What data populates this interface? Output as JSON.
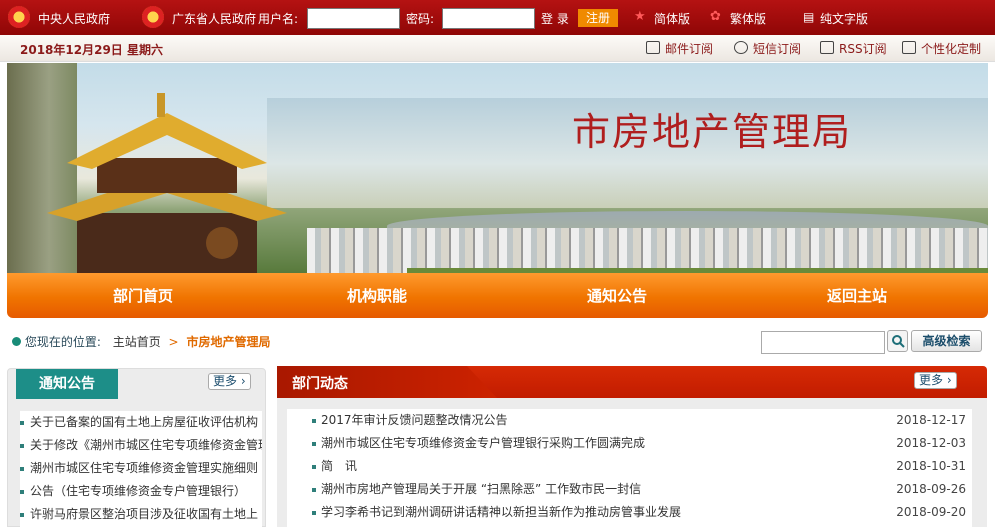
{
  "topbar": {
    "central_gov": "中央人民政府",
    "province_gov": "广东省人民政府",
    "username_label": "用户名:",
    "password_label": "密码:",
    "login_label": "登 录",
    "register_label": "注册",
    "simplified_label": "简体版",
    "traditional_label": "繁体版",
    "text_only_label": "纯文字版"
  },
  "datebar": {
    "date": "2018年12月29日 星期六",
    "email_sub": "邮件订阅",
    "sms_sub": "短信订阅",
    "rss_sub": "RSS订阅",
    "custom": "个性化定制"
  },
  "banner": {
    "title": "市房地产管理局"
  },
  "nav": {
    "items": [
      "部门首页",
      "机构职能",
      "通知公告",
      "返回主站"
    ]
  },
  "breadcrumb": {
    "label": "您现在的位置:",
    "home": "主站首页",
    "separator": ">",
    "current": "市房地产管理局"
  },
  "search": {
    "advanced_label": "高级检索"
  },
  "notices": {
    "title": "通知公告",
    "more": "更多",
    "items": [
      "关于已备案的国有土地上房屋征收评估机构",
      "关于修改《潮州市城区住宅专项维修资金管理",
      "潮州市城区住宅专项维修资金管理实施细则",
      "公告（住宅专项维修资金专户管理银行）",
      "许驸马府景区整治项目涉及征收国有土地上"
    ]
  },
  "news": {
    "title": "部门动态",
    "more": "更多",
    "items": [
      {
        "title": "2017年审计反馈问题整改情况公告",
        "date": "2018-12-17"
      },
      {
        "title": "潮州市城区住宅专项维修资金专户管理银行采购工作圆满完成",
        "date": "2018-12-03"
      },
      {
        "title": "简　讯",
        "date": "2018-10-31"
      },
      {
        "title": "潮州市房地产管理局关于开展 “扫黑除恶” 工作致市民一封信",
        "date": "2018-09-26"
      },
      {
        "title": "学习李希书记到潮州调研讲话精神以新担当新作为推动房管事业发展",
        "date": "2018-09-20"
      }
    ]
  },
  "colors": {
    "topbar": "#a30c0c",
    "nav": "#f07400",
    "accent_teal": "#1d8e88",
    "news_header": "#c81f00"
  }
}
